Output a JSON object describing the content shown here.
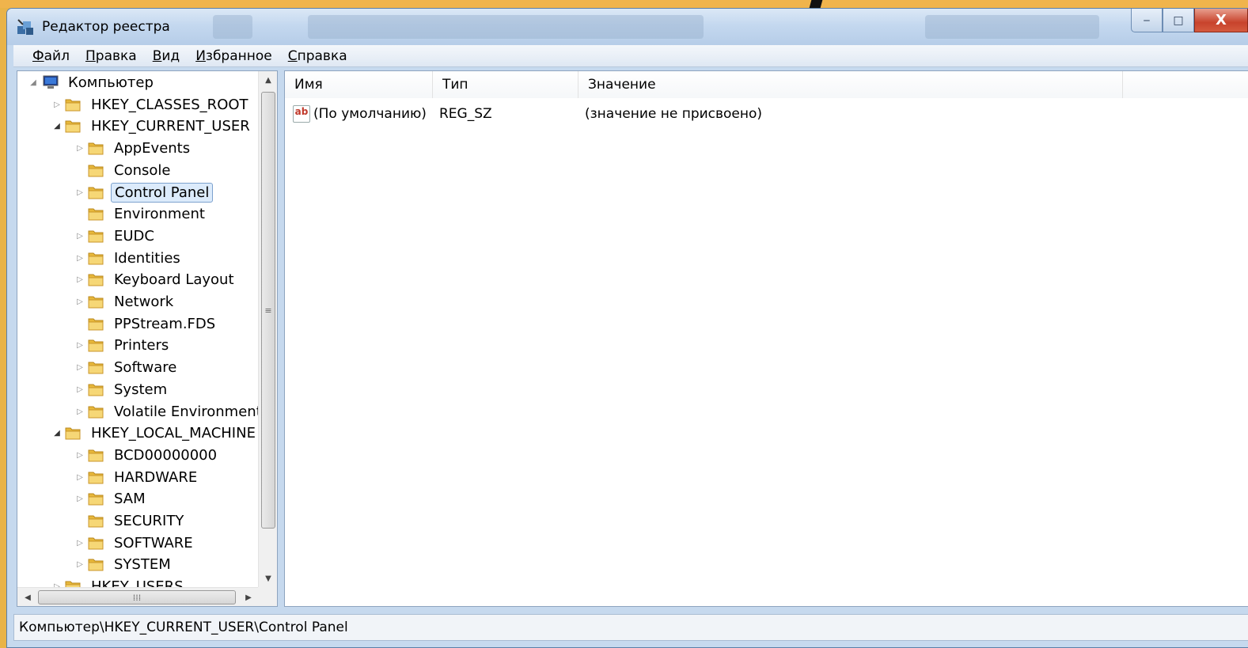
{
  "window": {
    "title": "Редактор реестра",
    "buttons": {
      "minimize": "‒",
      "maximize": "□",
      "close": "X"
    }
  },
  "menu": [
    {
      "label": "Файл"
    },
    {
      "label": "Правка"
    },
    {
      "label": "Вид"
    },
    {
      "label": "Избранное"
    },
    {
      "label": "Справка"
    }
  ],
  "tree": {
    "root": "Компьютер",
    "nodes": [
      {
        "label": "HKEY_CLASSES_ROOT",
        "depth": 1,
        "expander": "collapsed"
      },
      {
        "label": "HKEY_CURRENT_USER",
        "depth": 1,
        "expander": "expanded"
      },
      {
        "label": "AppEvents",
        "depth": 2,
        "expander": "collapsed"
      },
      {
        "label": "Console",
        "depth": 2,
        "expander": "none"
      },
      {
        "label": "Control Panel",
        "depth": 2,
        "expander": "collapsed",
        "selected": true
      },
      {
        "label": "Environment",
        "depth": 2,
        "expander": "none"
      },
      {
        "label": "EUDC",
        "depth": 2,
        "expander": "collapsed"
      },
      {
        "label": "Identities",
        "depth": 2,
        "expander": "collapsed"
      },
      {
        "label": "Keyboard Layout",
        "depth": 2,
        "expander": "collapsed"
      },
      {
        "label": "Network",
        "depth": 2,
        "expander": "collapsed"
      },
      {
        "label": "PPStream.FDS",
        "depth": 2,
        "expander": "none"
      },
      {
        "label": "Printers",
        "depth": 2,
        "expander": "collapsed"
      },
      {
        "label": "Software",
        "depth": 2,
        "expander": "collapsed"
      },
      {
        "label": "System",
        "depth": 2,
        "expander": "collapsed"
      },
      {
        "label": "Volatile Environment",
        "depth": 2,
        "expander": "collapsed"
      },
      {
        "label": "HKEY_LOCAL_MACHINE",
        "depth": 1,
        "expander": "expanded"
      },
      {
        "label": "BCD00000000",
        "depth": 2,
        "expander": "collapsed"
      },
      {
        "label": "HARDWARE",
        "depth": 2,
        "expander": "collapsed"
      },
      {
        "label": "SAM",
        "depth": 2,
        "expander": "collapsed"
      },
      {
        "label": "SECURITY",
        "depth": 2,
        "expander": "none"
      },
      {
        "label": "SOFTWARE",
        "depth": 2,
        "expander": "collapsed"
      },
      {
        "label": "SYSTEM",
        "depth": 2,
        "expander": "collapsed"
      },
      {
        "label": "HKEY_USERS",
        "depth": 1,
        "expander": "collapsed"
      }
    ]
  },
  "list": {
    "columns": [
      "Имя",
      "Тип",
      "Значение"
    ],
    "rows": [
      {
        "name": "(По умолчанию)",
        "type": "REG_SZ",
        "value": "(значение не присвоено)",
        "icon": "string-value-icon"
      }
    ]
  },
  "status": "Компьютер\\HKEY_CURRENT_USER\\Control Panel",
  "colors": {
    "accent": "#e9b347",
    "selection": "#dcebfb",
    "folder": "#e8b83a"
  }
}
